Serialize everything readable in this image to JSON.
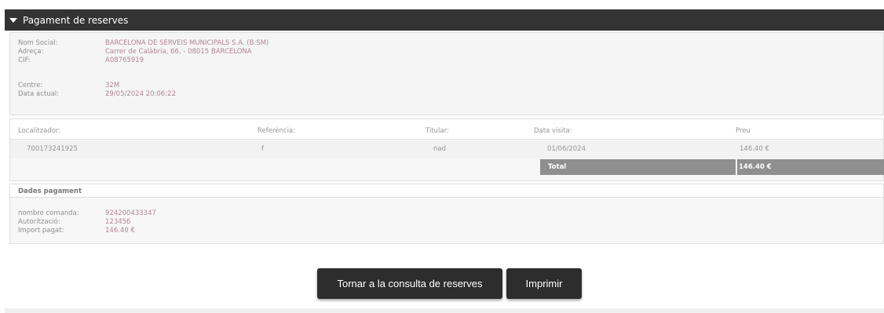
{
  "panel": {
    "title": "Pagament de reserves"
  },
  "company": {
    "nom_social_label": "Nom Social:",
    "nom_social_value": "BARCELONA DE SERVEIS MUNICIPALS S.A. (B:SM)",
    "adreca_label": "Adreça:",
    "adreca_value": "Carrer de Calàbria, 66, - 08015 BARCELONA",
    "cif_label": "CIF:",
    "cif_value": "A08765919",
    "centre_label": "Centre:",
    "centre_value": "32M",
    "data_label": "Data actual:",
    "data_value": "29/05/2024 20:06:22"
  },
  "reservations": {
    "headers": {
      "localitzador": "Localitzador:",
      "referencia": "Referència:",
      "titular": "Titular:",
      "data_visita": "Data visita:",
      "preu": "Preu"
    },
    "row": {
      "localitzador": "700173241925",
      "referencia": "f",
      "titular": "nad",
      "data_visita": "01/06/2024",
      "preu": "146.40 €"
    },
    "total_label": "Total",
    "total_value": "146.40 €"
  },
  "payment": {
    "title": "Dades pagament",
    "comanda_label": "nombre comanda:",
    "comanda_value": "924200433347",
    "autoritzacio_label": "Autorització:",
    "autoritzacio_value": "123456",
    "import_label": "Import pagat:",
    "import_value": "146.40 €"
  },
  "buttons": {
    "back_label": "Tornar a la consulta de reserves",
    "print_label": "Imprimir"
  },
  "icons": {
    "collapse": "triangle-down-icon"
  }
}
